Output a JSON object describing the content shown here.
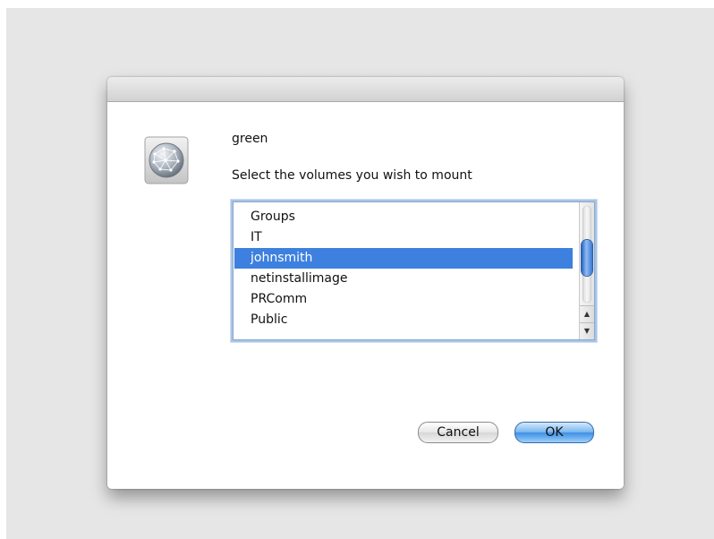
{
  "dialog": {
    "server_name": "green",
    "prompt": "Select the volumes you wish to mount",
    "icon": "network-globe-icon"
  },
  "volumes": {
    "items": [
      {
        "label": "Groups",
        "selected": false
      },
      {
        "label": "IT",
        "selected": false
      },
      {
        "label": "johnsmith",
        "selected": true
      },
      {
        "label": "netinstallimage",
        "selected": false
      },
      {
        "label": "PRComm",
        "selected": false
      },
      {
        "label": "Public",
        "selected": false
      }
    ]
  },
  "buttons": {
    "cancel_label": "Cancel",
    "ok_label": "OK"
  },
  "colors": {
    "selection": "#3d80df",
    "default_button": "#5aa3ea"
  }
}
